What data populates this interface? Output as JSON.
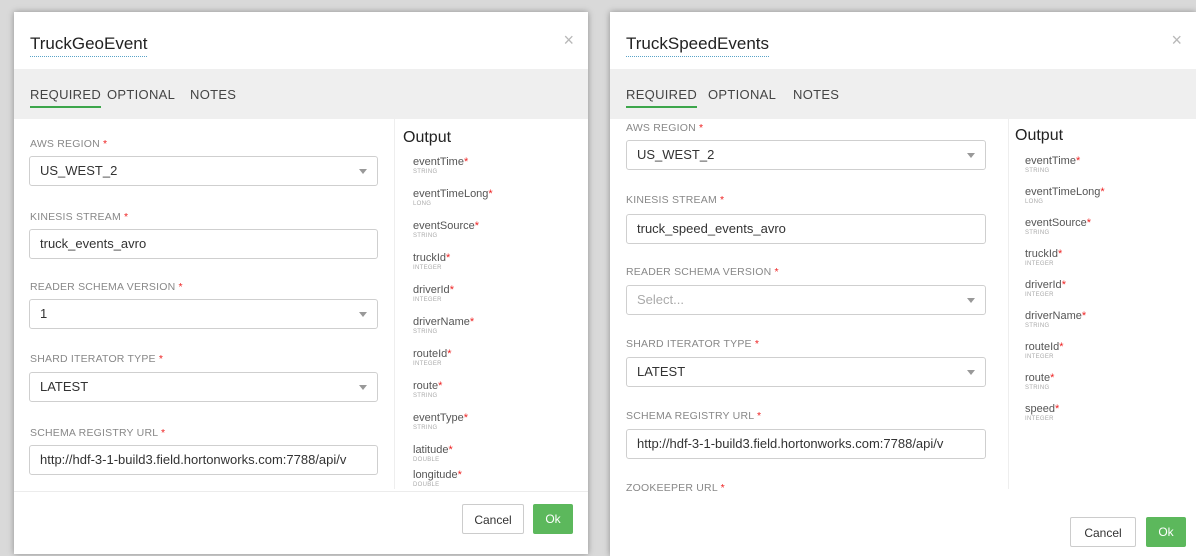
{
  "close_glyph": "×",
  "tabs": [
    "REQUIRED",
    "OPTIONAL",
    "NOTES"
  ],
  "output_title": "Output",
  "cancel_label": "Cancel",
  "ok_label": "Ok",
  "required_mark": "*",
  "modal1": {
    "title": "TruckGeoEvent",
    "fields": {
      "aws_region": {
        "label": "AWS REGION",
        "value": "US_WEST_2"
      },
      "kinesis_stream": {
        "label": "KINESIS STREAM",
        "value": "truck_events_avro"
      },
      "reader_schema_version": {
        "label": "READER SCHEMA VERSION",
        "value": "1"
      },
      "shard_iterator_type": {
        "label": "SHARD ITERATOR TYPE",
        "value": "LATEST"
      },
      "schema_registry_url": {
        "label": "SCHEMA REGISTRY URL",
        "value": "http://hdf-3-1-build3.field.hortonworks.com:7788/api/v"
      }
    },
    "output": [
      {
        "name": "eventTime",
        "type": "STRING"
      },
      {
        "name": "eventTimeLong",
        "type": "LONG"
      },
      {
        "name": "eventSource",
        "type": "STRING"
      },
      {
        "name": "truckId",
        "type": "INTEGER"
      },
      {
        "name": "driverId",
        "type": "INTEGER"
      },
      {
        "name": "driverName",
        "type": "STRING"
      },
      {
        "name": "routeId",
        "type": "INTEGER"
      },
      {
        "name": "route",
        "type": "STRING"
      },
      {
        "name": "eventType",
        "type": "STRING"
      },
      {
        "name": "latitude",
        "type": "DOUBLE"
      },
      {
        "name": "longitude",
        "type": "DOUBLE"
      }
    ]
  },
  "modal2": {
    "title": "TruckSpeedEvents",
    "fields": {
      "aws_region": {
        "label": "AWS REGION",
        "value": "US_WEST_2"
      },
      "kinesis_stream": {
        "label": "KINESIS STREAM",
        "value": "truck_speed_events_avro"
      },
      "reader_schema_version": {
        "label": "READER SCHEMA VERSION",
        "placeholder": "Select..."
      },
      "shard_iterator_type": {
        "label": "SHARD ITERATOR TYPE",
        "value": "LATEST"
      },
      "schema_registry_url": {
        "label": "SCHEMA REGISTRY URL",
        "value": "http://hdf-3-1-build3.field.hortonworks.com:7788/api/v"
      },
      "zookeeper_url": {
        "label": "ZOOKEEPER URL"
      }
    },
    "output": [
      {
        "name": "eventTime",
        "type": "STRING"
      },
      {
        "name": "eventTimeLong",
        "type": "LONG"
      },
      {
        "name": "eventSource",
        "type": "STRING"
      },
      {
        "name": "truckId",
        "type": "INTEGER"
      },
      {
        "name": "driverId",
        "type": "INTEGER"
      },
      {
        "name": "driverName",
        "type": "STRING"
      },
      {
        "name": "routeId",
        "type": "INTEGER"
      },
      {
        "name": "route",
        "type": "STRING"
      },
      {
        "name": "speed",
        "type": "INTEGER"
      }
    ]
  },
  "colors": {
    "accent": "#3ca64b",
    "ok_button": "#5cb85c",
    "required": "#e22222"
  }
}
